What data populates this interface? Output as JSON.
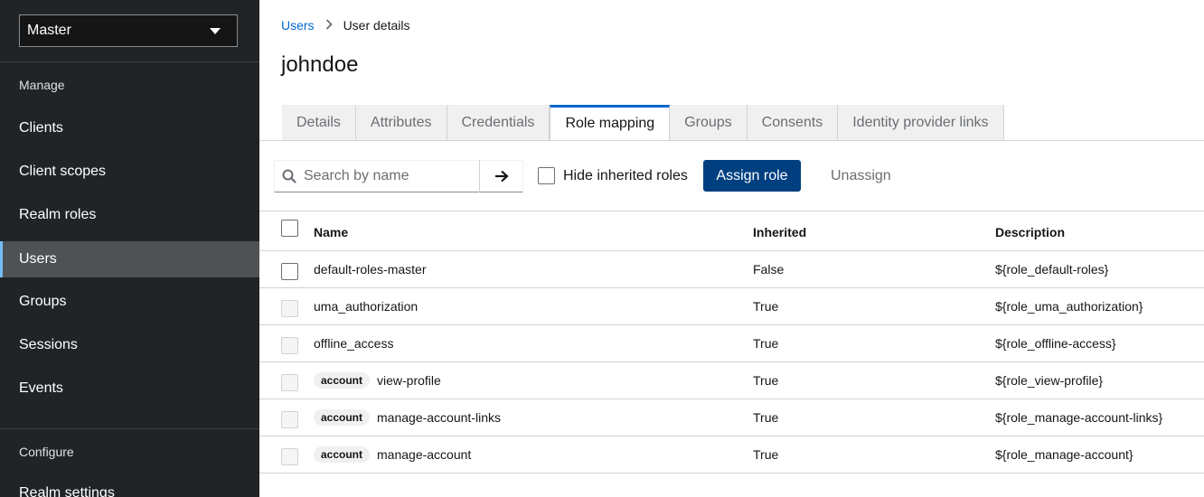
{
  "sidebar": {
    "realm": "Master",
    "sections": {
      "manage": "Manage",
      "configure": "Configure"
    },
    "items": [
      {
        "label": "Clients"
      },
      {
        "label": "Client scopes"
      },
      {
        "label": "Realm roles"
      },
      {
        "label": "Users",
        "active": true
      },
      {
        "label": "Groups"
      },
      {
        "label": "Sessions"
      },
      {
        "label": "Events"
      }
    ],
    "configure_items": [
      {
        "label": "Realm settings"
      }
    ]
  },
  "breadcrumb": {
    "parent": "Users",
    "current": "User details"
  },
  "page_title": "johndoe",
  "tabs": [
    {
      "label": "Details"
    },
    {
      "label": "Attributes"
    },
    {
      "label": "Credentials"
    },
    {
      "label": "Role mapping",
      "active": true
    },
    {
      "label": "Groups"
    },
    {
      "label": "Consents"
    },
    {
      "label": "Identity provider links"
    }
  ],
  "toolbar": {
    "search_placeholder": "Search by name",
    "hide_inherited_label": "Hide inherited roles",
    "assign_label": "Assign role",
    "unassign_label": "Unassign"
  },
  "table": {
    "columns": [
      "Name",
      "Inherited",
      "Description"
    ],
    "rows": [
      {
        "badge": "",
        "name": "default-roles-master",
        "inherited": "False",
        "description": "${role_default-roles}",
        "disabled": false
      },
      {
        "badge": "",
        "name": "uma_authorization",
        "inherited": "True",
        "description": "${role_uma_authorization}",
        "disabled": true
      },
      {
        "badge": "",
        "name": "offline_access",
        "inherited": "True",
        "description": "${role_offline-access}",
        "disabled": true
      },
      {
        "badge": "account",
        "name": "view-profile",
        "inherited": "True",
        "description": "${role_view-profile}",
        "disabled": true
      },
      {
        "badge": "account",
        "name": "manage-account-links",
        "inherited": "True",
        "description": "${role_manage-account-links}",
        "disabled": true
      },
      {
        "badge": "account",
        "name": "manage-account",
        "inherited": "True",
        "description": "${role_manage-account}",
        "disabled": true
      }
    ]
  },
  "colors": {
    "sidebar_bg": "#212427",
    "primary": "#004080",
    "link": "#0066cc",
    "active_tab_border": "#0066cc"
  }
}
